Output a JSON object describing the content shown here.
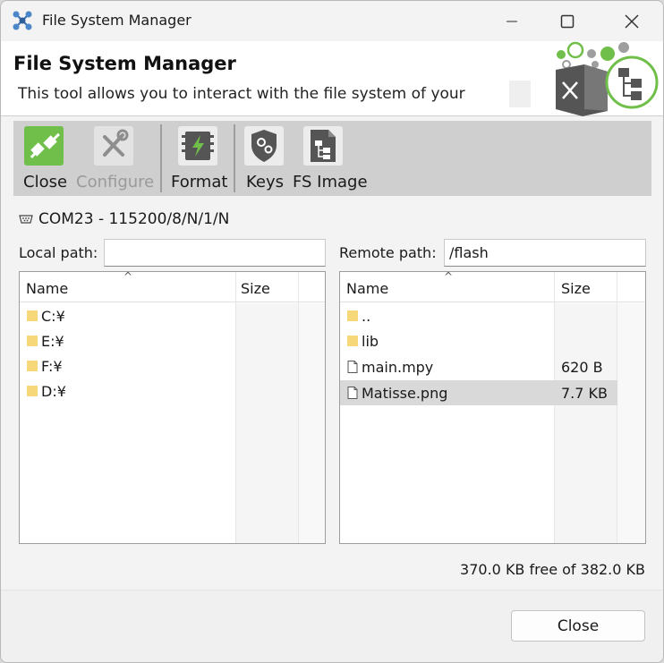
{
  "window": {
    "title": "File System Manager",
    "controls": {
      "minimize_icon": "minimize-icon",
      "maximize_icon": "maximize-icon",
      "close_icon": "close-icon"
    }
  },
  "header": {
    "title": "File System Manager",
    "description": "This tool allows you to interact with the file system of your"
  },
  "toolbar": {
    "items": [
      {
        "label": "Close",
        "icon": "disconnect-plug-icon",
        "enabled": true
      },
      {
        "label": "Configure",
        "icon": "tools-icon",
        "enabled": false
      },
      {
        "label": "Format",
        "icon": "format-chip-icon",
        "enabled": true
      },
      {
        "label": "Keys",
        "icon": "security-gear-icon",
        "enabled": true
      },
      {
        "label": "FS Image",
        "icon": "fs-image-icon",
        "enabled": true
      }
    ]
  },
  "connection": {
    "text": "COM23 - 115200/8/N/1/N"
  },
  "local": {
    "path_label": "Local path:",
    "path_value": "",
    "columns": {
      "name": "Name",
      "size": "Size"
    },
    "rows": [
      {
        "name": "C:¥",
        "size": "",
        "type": "folder"
      },
      {
        "name": "E:¥",
        "size": "",
        "type": "folder"
      },
      {
        "name": "F:¥",
        "size": "",
        "type": "folder"
      },
      {
        "name": "D:¥",
        "size": "",
        "type": "folder"
      }
    ]
  },
  "remote": {
    "path_label": "Remote path:",
    "path_value": "/flash",
    "columns": {
      "name": "Name",
      "size": "Size"
    },
    "rows": [
      {
        "name": "..",
        "size": "",
        "type": "folder"
      },
      {
        "name": "lib",
        "size": "",
        "type": "folder"
      },
      {
        "name": "main.mpy",
        "size": "620 B",
        "type": "file"
      },
      {
        "name": "Matisse.png",
        "size": "7.7 KB",
        "type": "file",
        "selected": true
      }
    ]
  },
  "status": {
    "free_space": "370.0 KB free of 382.0 KB"
  },
  "footer": {
    "close_label": "Close"
  },
  "colors": {
    "accent_green": "#6fbf4a",
    "toolbar_bg": "#cfcfcf",
    "selected_row": "#d9d9d9"
  }
}
